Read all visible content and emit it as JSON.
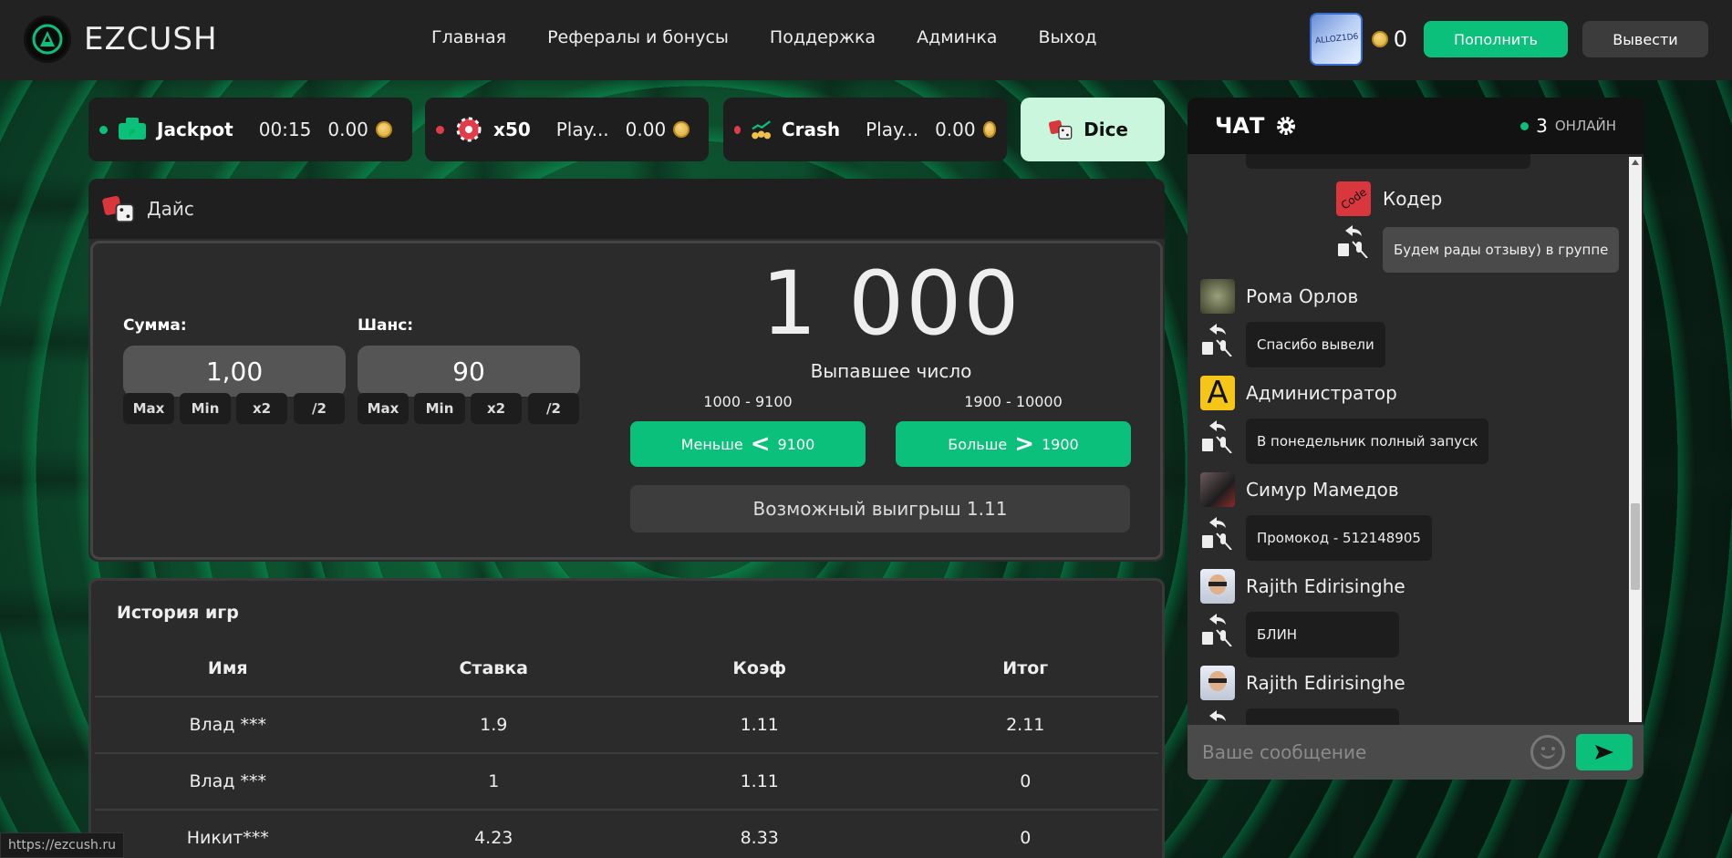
{
  "brand": {
    "name": "EZCUSH"
  },
  "nav": [
    "Главная",
    "Рефералы и бонусы",
    "Поддержка",
    "Админка",
    "Выход"
  ],
  "user": {
    "avatar_text": "ALLOZ1D6",
    "balance": "0"
  },
  "header_buttons": {
    "deposit": "Пополнить",
    "withdraw": "Вывести"
  },
  "colors": {
    "accent": "#0bc07a",
    "status_green": "#0bc07a",
    "status_red": "#e23b4a",
    "active_tab": "#c9f6dc"
  },
  "games": [
    {
      "name": "Jackpot",
      "status": "green",
      "stat": "00:15",
      "value": "0.00",
      "icon": "jackpot-icon"
    },
    {
      "name": "x50",
      "status": "red",
      "stat": "",
      "value": "",
      "icon": "roulette-wheel-icon"
    },
    {
      "name": "Crash",
      "status": "red",
      "stat": "Play...",
      "value": "0.00",
      "icon": "crash-chart-icon"
    },
    {
      "name": "Dice",
      "status": "active",
      "stat": "",
      "value": "",
      "icon": "dice-icon"
    }
  ],
  "x50_extra": {
    "stat": "Play...",
    "value": "0.00"
  },
  "dice": {
    "title": "Дайс",
    "amount_label": "Сумма:",
    "amount_value": "1,00",
    "chance_label": "Шанс:",
    "chance_value": "90",
    "mini_buttons": [
      "Max",
      "Min",
      "x2",
      "/2"
    ],
    "rolled_number": "1 000",
    "rolled_label": "Выпавшее число",
    "less_range": "1000 - 9100",
    "more_range": "1900 - 10000",
    "less_label": "Меньше",
    "less_value": "9100",
    "more_label": "Больше",
    "more_value": "1900",
    "possible_win": "Возможный выигрыш 1.11"
  },
  "history": {
    "title": "История игр",
    "columns": [
      "Имя",
      "Ставка",
      "Коэф",
      "Итог"
    ],
    "rows": [
      [
        "Влад ***",
        "1.9",
        "1.11",
        "2.11"
      ],
      [
        "Влад ***",
        "1",
        "1.11",
        "0"
      ],
      [
        "Никит***",
        "4.23",
        "8.33",
        "0"
      ]
    ]
  },
  "chat": {
    "title": "ЧАТ",
    "online_count": "3",
    "online_label": "ОНЛАЙН",
    "input_placeholder": "Ваше сообщение",
    "messages": [
      {
        "name": "Кодер",
        "text": "Будем рады отзыву) в группе",
        "avatar": "Code"
      },
      {
        "name": "Рома Орлов",
        "text": "Спасибо вывели"
      },
      {
        "name": "Администратор",
        "text": "В понедельник полный запуск",
        "avatar": "A"
      },
      {
        "name": "Симур Мамедов",
        "text": "Промокод - 512148905"
      },
      {
        "name": "Rajith Edirisinghe",
        "text": "БЛИН"
      },
      {
        "name": "Rajith Edirisinghe",
        "text": ""
      }
    ]
  },
  "status_url": "https://ezcush.ru"
}
